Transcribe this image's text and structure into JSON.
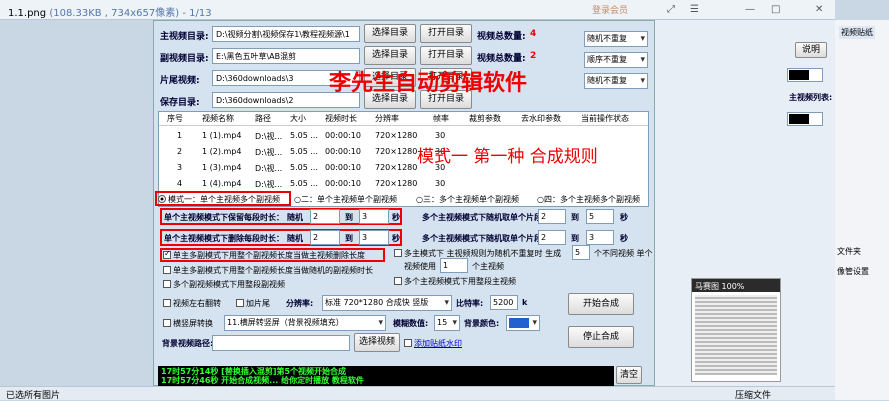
{
  "viewer": {
    "filename": "1.1.png",
    "meta": "(108.33KB , 734x657像素) - 1/13",
    "login": "登录会员",
    "status_left": "已选所有图片",
    "status_right": "压缩文件"
  },
  "dirs": [
    {
      "label": "主视频目录:",
      "value": "D:\\视频分割\\视频保存1\\教程视频源\\1",
      "button": "选择目录",
      "open": "打开目录",
      "stat_label": "视频总数量:",
      "stat_value": "4"
    },
    {
      "label": "副视频目录:",
      "value": "E:\\黑色五叶草\\AB混剪",
      "button": "选择目录",
      "open": "打开目录",
      "stat_label": "视频总数量:",
      "stat_value": "2"
    },
    {
      "label": "片尾视频:",
      "value": "D:\\360downloads\\3",
      "button": "选择目录",
      "open": "打开目录",
      "stat_label": "",
      "stat_value": ""
    },
    {
      "label": "保存目录:",
      "value": "D:\\360downloads\\2",
      "button": "选择目录",
      "open": "打开目录",
      "stat_label": "",
      "stat_value": ""
    }
  ],
  "selects": [
    "随机不重复",
    "顺序不重复",
    "随机不重复"
  ],
  "overlay": {
    "title": "李先生自动剪辑软件",
    "mode": "模式一  第一种 合成规则"
  },
  "table": {
    "headers": [
      "序号",
      "视频名称",
      "路径",
      "大小",
      "视频时长",
      "分辨率",
      "帧率",
      "裁剪参数",
      "去水印参数",
      "当前操作状态"
    ],
    "rows": [
      [
        "1",
        "1 (1).mp4",
        "D:\\视...",
        "5.05 ...",
        "00:00:10",
        "720×1280",
        "30"
      ],
      [
        "2",
        "1 (2).mp4",
        "D:\\视...",
        "5.05 ...",
        "00:00:10",
        "720×1280",
        "30"
      ],
      [
        "3",
        "1 (3).mp4",
        "D:\\视...",
        "5.05 ...",
        "00:00:10",
        "720×1280",
        "30"
      ],
      [
        "4",
        "1 (4).mp4",
        "D:\\视...",
        "5.05 ...",
        "00:00:10",
        "720×1280",
        "30"
      ]
    ]
  },
  "modes": [
    "模式一：单个主视频多个副视频",
    "○二：单个主视频单个副视频",
    "○三：多个主视频单个副视频",
    "○四：多个主视频多个副视频"
  ],
  "single": {
    "keep_label": "单个主视频模式下保留每段时长：",
    "delete_label": "单个主视频模式下删除每段时长：",
    "random": "随机",
    "to": "到",
    "unit": "秒",
    "keep_from": "2",
    "keep_to": "3",
    "del_from": "2",
    "del_to": "3"
  },
  "multi": {
    "keep_label": "多个主视频模式下随机取单个片段：",
    "delete_label": "多个主视频模式下随机取单个片段：",
    "keep_from": "2",
    "keep_to": "5",
    "del_from": "2",
    "del_to": "3"
  },
  "checks": {
    "c1": "单主多副模式下用整个副视频长度当做主视频删除长度",
    "c2": "单主多副模式下用整个副视频长度当做随机的副视频时长",
    "c3": "多个副视频模式下用整段副视频",
    "c4": "多个主视频模式下用整段主视频",
    "m1a": "多主模式下 主视频规则为随机不重复时 生成",
    "m1b": "5",
    "m1c": "个不同视频 单个",
    "m1d": "视频使用",
    "m1e": "1",
    "m1f": "个主视频"
  },
  "bottom": {
    "flip": "视频左右翻转",
    "tail": "加片尾",
    "res_label": "分辨率:",
    "res_value": "标准 720*1280 合成快 竖版",
    "bitrate_label": "比特率:",
    "bitrate_value": "5200",
    "bitrate_unit": "k",
    "rotate": "横竖屏转换",
    "rotate_value": "11.横屏转竖屏（背景视频填充）",
    "blur_label": "模糊数值:",
    "blur_value": "15",
    "bgcolor_label": "背景颜色:",
    "bgvideo_label": "背景视频路径:",
    "pick_video": "选择视频",
    "watermark": "添加贴纸水印",
    "start": "开始合成",
    "stop": "停止合成",
    "clear": "清空"
  },
  "log": [
    "17时57分14秒 [替换插入混剪]第5个视频开始合成",
    "17时57分46秒 开始合成视频...   给你定时播放   教程软件"
  ],
  "right_panel": {
    "label": "主视频列表:",
    "explain": "说明",
    "chip": "视频贴纸",
    "thumb_title": "马赛图 100%",
    "file_type": "文件夹",
    "compress": "像管设置"
  }
}
